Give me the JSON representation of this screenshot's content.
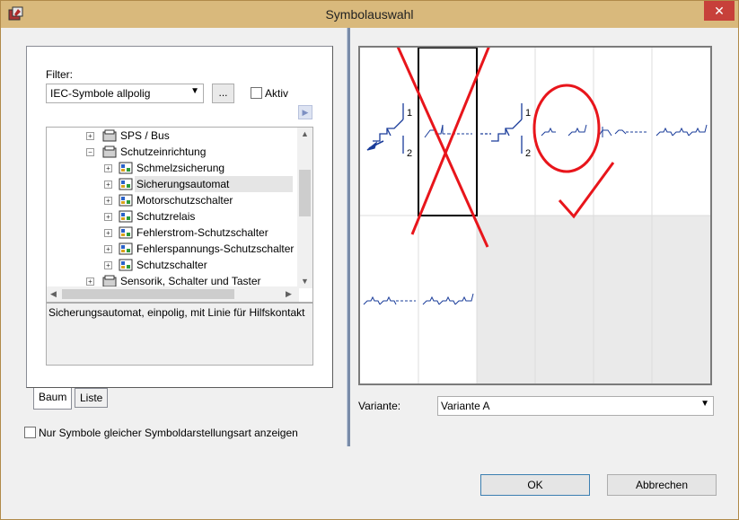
{
  "window": {
    "title": "Symbolauswahl",
    "close_glyph": "✕"
  },
  "filter": {
    "label": "Filter:",
    "value": "IEC-Symbole allpolig",
    "more_button": "...",
    "aktiv_label": "Aktiv",
    "aktiv_checked": false
  },
  "tree": {
    "items": [
      {
        "label": "SPS / Bus",
        "level": 1,
        "state": "collapsed",
        "icon": "folder-icon"
      },
      {
        "label": "Schutzeinrichtung",
        "level": 1,
        "state": "expanded",
        "icon": "folder-icon"
      },
      {
        "label": "Schmelzsicherung",
        "level": 2,
        "state": "collapsed",
        "icon": "symbol-icon"
      },
      {
        "label": "Sicherungsautomat",
        "level": 2,
        "state": "collapsed",
        "icon": "symbol-icon",
        "selected": true
      },
      {
        "label": "Motorschutzschalter",
        "level": 2,
        "state": "collapsed",
        "icon": "symbol-icon"
      },
      {
        "label": "Schutzrelais",
        "level": 2,
        "state": "collapsed",
        "icon": "symbol-icon"
      },
      {
        "label": "Fehlerstrom-Schutzschalter",
        "level": 2,
        "state": "collapsed",
        "icon": "symbol-icon"
      },
      {
        "label": "Fehlerspannungs-Schutzschalter",
        "level": 2,
        "state": "collapsed",
        "icon": "symbol-icon"
      },
      {
        "label": "Schutzschalter",
        "level": 2,
        "state": "collapsed",
        "icon": "symbol-icon"
      },
      {
        "label": "Sensorik, Schalter und Taster",
        "level": 1,
        "state": "collapsed",
        "icon": "folder-icon"
      }
    ]
  },
  "description": "Sicherungsautomat, einpolig, mit Linie für Hilfskontakt",
  "tabs": [
    {
      "label": "Baum",
      "active": true
    },
    {
      "label": "Liste",
      "active": false
    }
  ],
  "nur_symbole": {
    "label": "Nur Symbole gleicher Symboldarstellungsart anzeigen",
    "checked": false
  },
  "symbol_grid": {
    "pin_labels": [
      "1",
      "2",
      "1",
      "2"
    ],
    "selected_cell": 1
  },
  "variante": {
    "label": "Variante:",
    "value": "Variante A"
  },
  "buttons": {
    "ok": "OK",
    "cancel": "Abbrechen"
  },
  "colors": {
    "annotation": "#e8151b",
    "symbol_blue": "#1a3c9a",
    "titlebar": "#d9b97c"
  }
}
